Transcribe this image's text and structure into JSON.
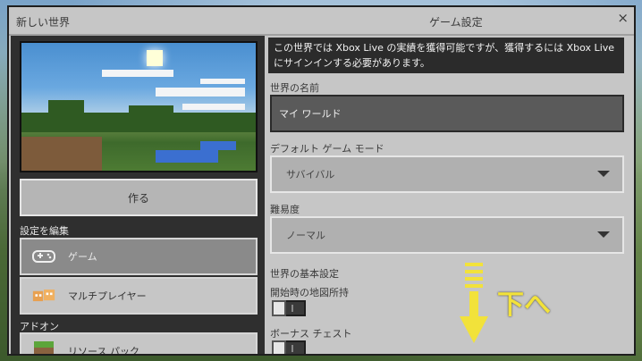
{
  "window": {
    "left_title": "新しい世界",
    "right_title": "ゲーム設定",
    "close_glyph": "×"
  },
  "left": {
    "create_button": "作る",
    "edit_settings_label": "設定を編集",
    "items": [
      {
        "label": "ゲーム",
        "icon": "gamepad-icon",
        "selected": true
      },
      {
        "label": "マルチプレイヤー",
        "icon": "players-icon",
        "selected": false
      }
    ],
    "addons_label": "アドオン",
    "addon_item": {
      "label": "リソース パック",
      "icon": "grass-block-icon"
    }
  },
  "right": {
    "notice": "この世界では Xbox Live の実績を獲得可能ですが、獲得するには Xbox Live にサインインする必要があります。",
    "world_name_label": "世界の名前",
    "world_name_value": "マイ ワールド",
    "game_mode_label": "デフォルト ゲーム モード",
    "game_mode_value": "サバイバル",
    "difficulty_label": "難易度",
    "difficulty_value": "ノーマル",
    "basic_settings_label": "世界の基本設定",
    "starting_map_label": "開始時の地図所持",
    "bonus_chest_label": "ボーナス チェスト"
  },
  "annotation": {
    "text": "下へ",
    "color": "#f2e23a"
  }
}
